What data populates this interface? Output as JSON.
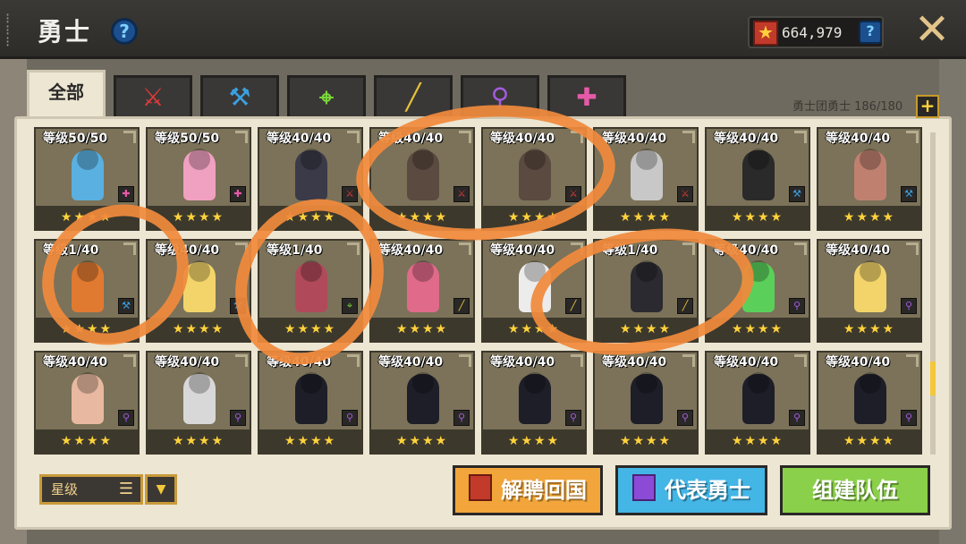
{
  "header": {
    "title": "勇士",
    "help": "?",
    "currency_amount": "664,979",
    "currency_help": "?",
    "close": "✕"
  },
  "tabs": [
    {
      "label": "全部",
      "active": true
    },
    {
      "label": "",
      "icon": "sword-icon",
      "color": "#e23a3a"
    },
    {
      "label": "",
      "icon": "hammer-icon",
      "color": "#3aa0e0"
    },
    {
      "label": "",
      "icon": "bow-icon",
      "color": "#7ad63a"
    },
    {
      "label": "",
      "icon": "rifle-icon",
      "color": "#e7c23a"
    },
    {
      "label": "",
      "icon": "staff-icon",
      "color": "#a35ce0"
    },
    {
      "label": "",
      "icon": "support-icon",
      "color": "#e55aa8"
    }
  ],
  "squad": {
    "label": "勇士团勇士 186/180",
    "plus": "+"
  },
  "cards": [
    {
      "level": "等级50/50",
      "stars": "★★★★",
      "weapon": "support-icon",
      "weapon_color": "#e55aa8",
      "portrait": "#5ab0e0"
    },
    {
      "level": "等级50/50",
      "stars": "★★★★",
      "weapon": "support-icon",
      "weapon_color": "#e55aa8",
      "portrait": "#f0a0c0"
    },
    {
      "level": "等级40/40",
      "stars": "★★★★",
      "weapon": "sword-icon",
      "weapon_color": "#e23a3a",
      "portrait": "#3a3a48"
    },
    {
      "level": "等级40/40",
      "stars": "★★★★",
      "weapon": "sword-icon",
      "weapon_color": "#e23a3a",
      "portrait": "#5a4a40"
    },
    {
      "level": "等级40/40",
      "stars": "★★★★",
      "weapon": "sword-icon",
      "weapon_color": "#e23a3a",
      "portrait": "#5a4a40"
    },
    {
      "level": "等级40/40",
      "stars": "★★★★",
      "weapon": "sword-icon",
      "weapon_color": "#e23a3a",
      "portrait": "#c8c8c8"
    },
    {
      "level": "等级40/40",
      "stars": "★★★★",
      "weapon": "hammer-icon",
      "weapon_color": "#3aa0e0",
      "portrait": "#2a2a2a"
    },
    {
      "level": "等级40/40",
      "stars": "★★★★",
      "weapon": "hammer-icon",
      "weapon_color": "#3aa0e0",
      "portrait": "#c08070"
    },
    {
      "level": "等级1/40",
      "stars": "★★★★",
      "weapon": "hammer-icon",
      "weapon_color": "#3aa0e0",
      "portrait": "#e07a30"
    },
    {
      "level": "等级40/40",
      "stars": "★★★★",
      "weapon": "hammer-icon",
      "weapon_color": "#3aa0e0",
      "portrait": "#f2d46a"
    },
    {
      "level": "等级1/40",
      "stars": "★★★★",
      "weapon": "bow-icon",
      "weapon_color": "#7ad63a",
      "portrait": "#b04a5a"
    },
    {
      "level": "等级40/40",
      "stars": "★★★★",
      "weapon": "rifle-icon",
      "weapon_color": "#e7c23a",
      "portrait": "#e06a8a"
    },
    {
      "level": "等级40/40",
      "stars": "★★★★",
      "weapon": "rifle-icon",
      "weapon_color": "#e7c23a",
      "portrait": "#ececec"
    },
    {
      "level": "等级1/40",
      "stars": "★★★★",
      "weapon": "rifle-icon",
      "weapon_color": "#e7c23a",
      "portrait": "#2a2a30"
    },
    {
      "level": "等级40/40",
      "stars": "★★★★",
      "weapon": "staff-icon",
      "weapon_color": "#a35ce0",
      "portrait": "#5ad05a"
    },
    {
      "level": "等级40/40",
      "stars": "★★★★",
      "weapon": "staff-icon",
      "weapon_color": "#a35ce0",
      "portrait": "#f2d46a"
    },
    {
      "level": "等级40/40",
      "stars": "★★★★",
      "weapon": "staff-icon",
      "weapon_color": "#a35ce0",
      "portrait": "#e8b8a0"
    },
    {
      "level": "等级40/40",
      "stars": "★★★★",
      "weapon": "staff-icon",
      "weapon_color": "#a35ce0",
      "portrait": "#d8d8d8"
    },
    {
      "level": "等级40/40",
      "stars": "★★★★",
      "weapon": "staff-icon",
      "weapon_color": "#a35ce0",
      "portrait": "#1e1e28"
    },
    {
      "level": "等级40/40",
      "stars": "★★★★",
      "weapon": "staff-icon",
      "weapon_color": "#a35ce0",
      "portrait": "#1e1e28"
    },
    {
      "level": "等级40/40",
      "stars": "★★★★",
      "weapon": "staff-icon",
      "weapon_color": "#a35ce0",
      "portrait": "#1e1e28"
    },
    {
      "level": "等级40/40",
      "stars": "★★★★",
      "weapon": "staff-icon",
      "weapon_color": "#a35ce0",
      "portrait": "#1e1e28"
    },
    {
      "level": "等级40/40",
      "stars": "★★★★",
      "weapon": "staff-icon",
      "weapon_color": "#a35ce0",
      "portrait": "#1e1e28"
    },
    {
      "level": "等级40/40",
      "stars": "★★★★",
      "weapon": "staff-icon",
      "weapon_color": "#a35ce0",
      "portrait": "#1e1e28"
    }
  ],
  "sort": {
    "label": "星级",
    "icon": "list-icon",
    "toggle": "▼"
  },
  "buttons": {
    "release": "解聘回国",
    "representative": "代表勇士",
    "team": "组建队伍"
  }
}
